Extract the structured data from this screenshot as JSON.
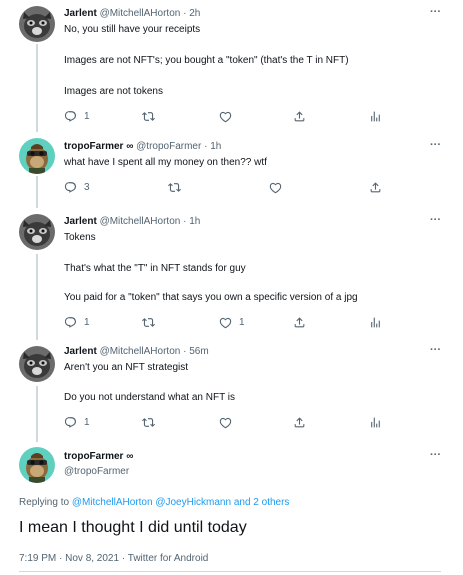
{
  "tweets": [
    {
      "name": "Jarlent",
      "handle": "@MitchellAHorton",
      "time": "2h",
      "lines": [
        "No, you still have your receipts",
        "Images are not NFT's; you bought a \"token\" (that's the T in NFT)",
        "Images are not tokens"
      ],
      "replies": "1",
      "retweets": "",
      "likes": ""
    },
    {
      "name": "tropoFarmer ∞",
      "handle": "@tropoFarmer",
      "time": "1h",
      "lines": [
        "what have I spent all my money on then?? wtf"
      ],
      "replies": "3",
      "retweets": "",
      "likes": ""
    },
    {
      "name": "Jarlent",
      "handle": "@MitchellAHorton",
      "time": "1h",
      "lines": [
        "Tokens",
        "That's what the \"T\" in NFT stands for guy",
        "You paid for a \"token\" that says you own a specific version of a jpg"
      ],
      "replies": "1",
      "retweets": "",
      "likes": "1"
    },
    {
      "name": "Jarlent",
      "handle": "@MitchellAHorton",
      "time": "56m",
      "lines": [
        "Aren't you an NFT strategist",
        "Do you not understand what an NFT is"
      ],
      "replies": "1",
      "retweets": "",
      "likes": ""
    }
  ],
  "focus": {
    "name": "tropoFarmer ∞",
    "handle": "@tropoFarmer",
    "replying_prefix": "Replying to ",
    "replying_to": "@MitchellAHorton @JoeyHickmann and 2 others",
    "text": "I mean I thought I did until today",
    "meta": "7:19 PM · Nov 8, 2021 · Twitter for Android"
  },
  "more_glyph": "···",
  "dot": "·",
  "colors": {
    "accent": "#1d9bf0",
    "text": "#0f1419",
    "secondary": "#536471",
    "thread_line": "#cfd9de"
  },
  "icons": {
    "reply": "reply-icon",
    "retweet": "retweet-icon",
    "like": "heart-icon",
    "share": "share-icon",
    "analytics": "analytics-icon",
    "more": "more-icon"
  }
}
